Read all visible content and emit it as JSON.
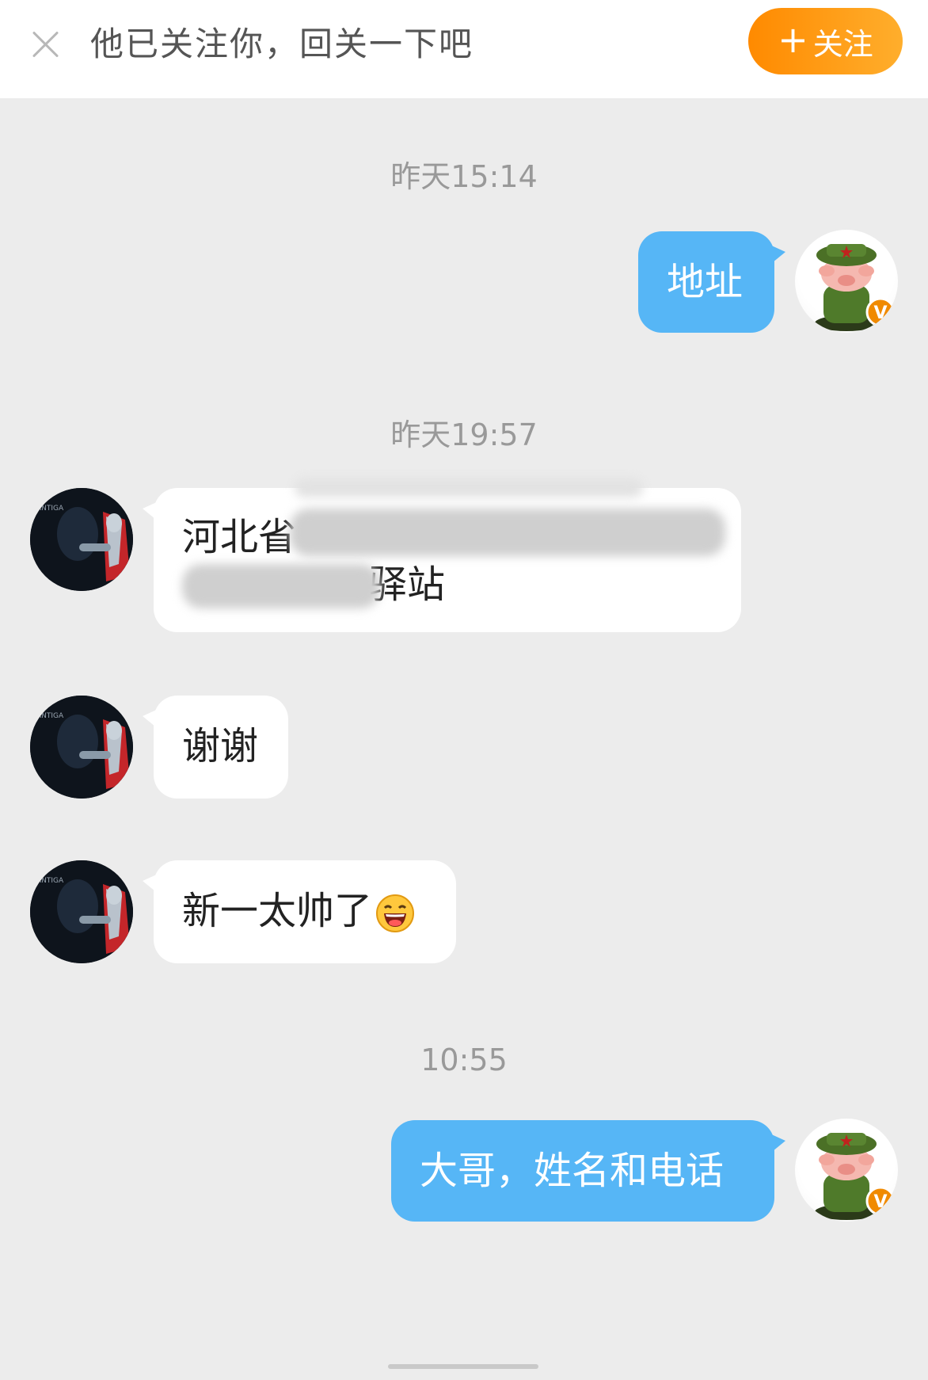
{
  "banner": {
    "text": "他已关注你，回关一下吧",
    "follow_plus": "+",
    "follow_label": "关注"
  },
  "messages": [
    {
      "type": "time",
      "text": "昨天15:14"
    },
    {
      "type": "outgoing",
      "text": "地址"
    },
    {
      "type": "time",
      "text": "昨天19:57"
    },
    {
      "type": "incoming",
      "line1": "河北省",
      "line2": "驿站",
      "note": "address partially blurred"
    },
    {
      "type": "incoming",
      "text": "谢谢"
    },
    {
      "type": "incoming",
      "text": "新一太帅了",
      "emoji": "laughing-emoji"
    },
    {
      "type": "time",
      "text": "10:55"
    },
    {
      "type": "outgoing",
      "text": "大哥，姓名和电话"
    }
  ],
  "avatars": {
    "self": "pig-soldier-avatar",
    "self_badge": "V",
    "other": "ultraman-avatar",
    "other_caption": "ANTIGA"
  },
  "colors": {
    "outgoing_bubble": "#56b6f6",
    "incoming_bubble": "#ffffff",
    "background": "#ececec",
    "follow_button": "#ff9a14"
  }
}
